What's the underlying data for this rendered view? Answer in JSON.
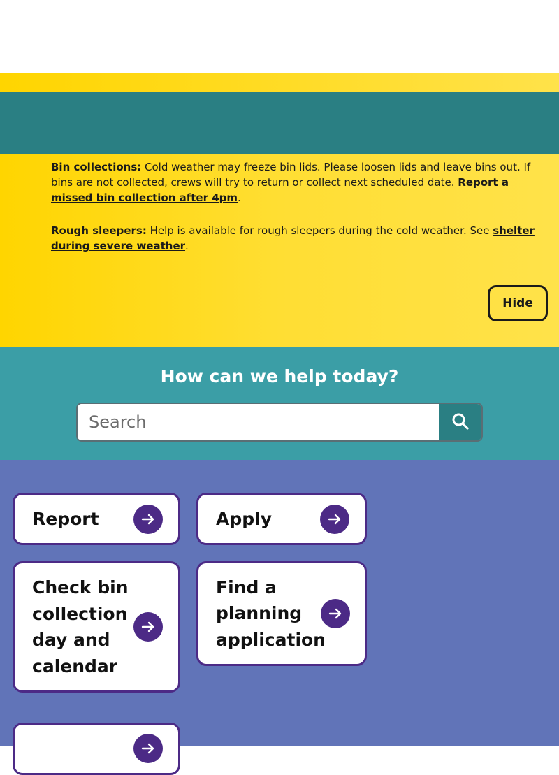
{
  "alert": {
    "bin_title": "Bin collections:",
    "bin_text": " Cold weather may freeze bin lids. Please loosen lids and leave bins out. If bins are not collected, crews will try to return or collect next scheduled date. ",
    "bin_link": "Report a missed bin collection after 4pm",
    "bin_end": ".",
    "rough_title": "Rough sleepers:",
    "rough_text": " Help is available for rough sleepers during the cold weather. See ",
    "rough_link": "shelter during severe weather",
    "rough_end": ".",
    "hide_label": "Hide"
  },
  "search": {
    "title": "How can we help today?",
    "placeholder": "Search",
    "icon": "search-icon"
  },
  "tiles": [
    {
      "label": "Report",
      "icon": "arrow-right-icon"
    },
    {
      "label": "Apply",
      "icon": "arrow-right-icon"
    },
    {
      "label": "Check bin collection day and calendar",
      "icon": "arrow-right-icon"
    },
    {
      "label": "Find a planning application",
      "icon": "arrow-right-icon"
    }
  ],
  "colors": {
    "alert_yellow": "#ffd500",
    "teal_dark": "#2a7f83",
    "teal": "#3b9ea6",
    "tiles_bg": "#6174b8",
    "accent_purple": "#4c2a86"
  }
}
